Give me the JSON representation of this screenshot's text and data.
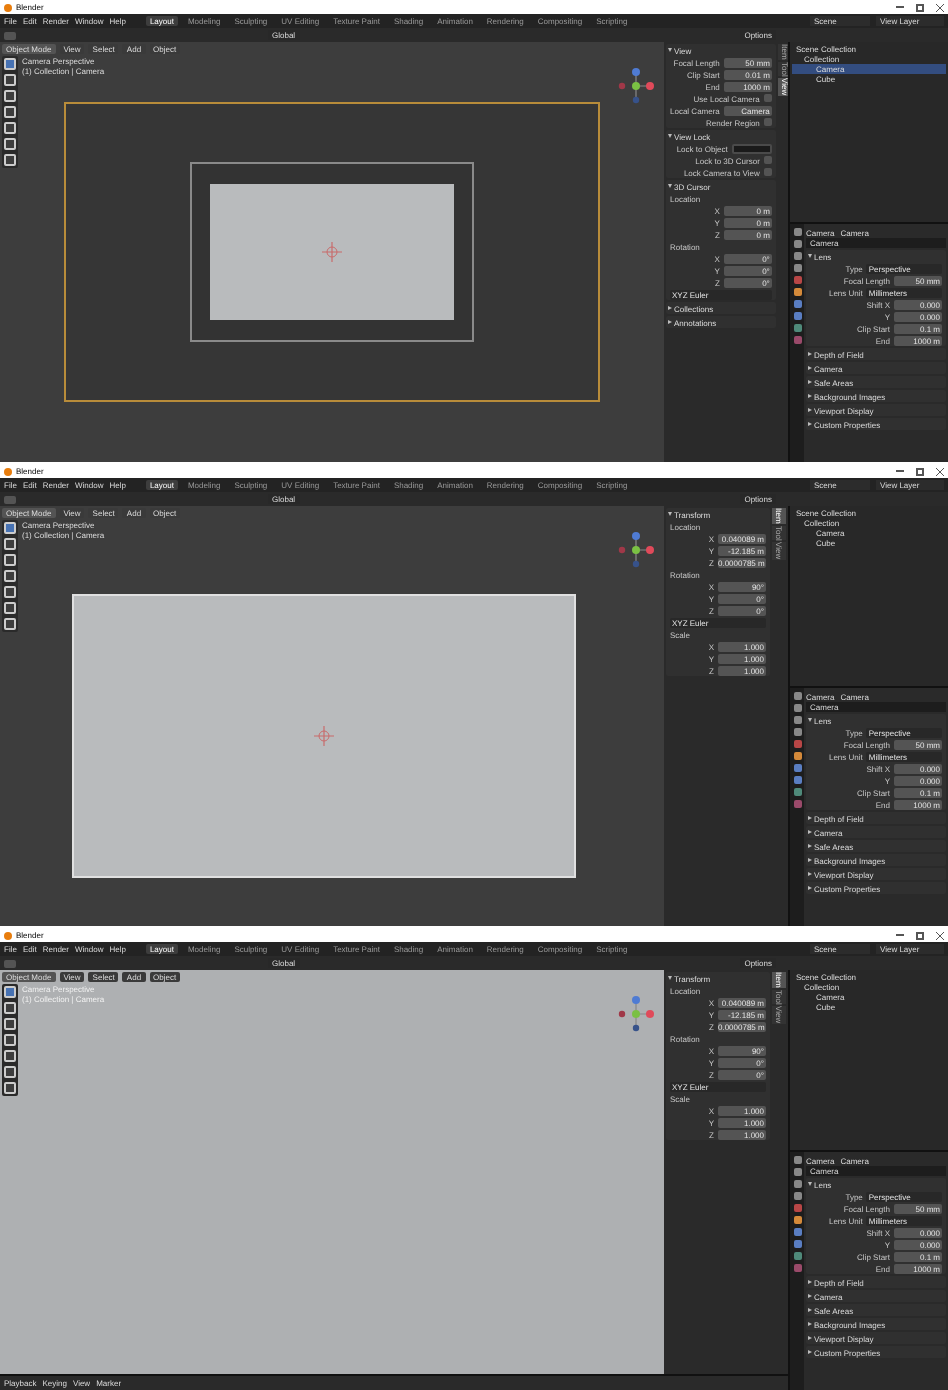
{
  "windows": [
    {
      "title": "Blender",
      "menus": [
        "File",
        "Edit",
        "Render",
        "Window",
        "Help"
      ],
      "workspaces": [
        {
          "label": "Layout",
          "selected": true
        },
        {
          "label": "Modeling",
          "selected": false
        },
        {
          "label": "Sculpting",
          "selected": false
        },
        {
          "label": "UV Editing",
          "selected": false
        },
        {
          "label": "Texture Paint",
          "selected": false
        },
        {
          "label": "Shading",
          "selected": false
        },
        {
          "label": "Animation",
          "selected": false
        },
        {
          "label": "Rendering",
          "selected": false
        },
        {
          "label": "Compositing",
          "selected": false
        },
        {
          "label": "Scripting",
          "selected": false
        }
      ],
      "scene": "Scene",
      "view_layer": "View Layer",
      "header_menus": [
        "Object Mode",
        "View",
        "Select",
        "Add",
        "Object"
      ],
      "orientation": "Global",
      "options": "Options",
      "viewport_info": [
        "Camera Perspective",
        "(1) Collection | Camera"
      ],
      "viewport": {
        "kind": "camera_frame"
      },
      "sidebar_tabs": [
        {
          "label": "Item",
          "selected": false
        },
        {
          "label": "Tool",
          "selected": false
        },
        {
          "label": "View",
          "selected": true
        }
      ],
      "sidebar_panels": [
        {
          "title": "View",
          "expanded": true,
          "rows": [
            {
              "kind": "field",
              "label": "Focal Length",
              "value": "50 mm"
            },
            {
              "kind": "field",
              "label": "Clip Start",
              "value": "0.01 m"
            },
            {
              "kind": "field",
              "label": "End",
              "value": "1000 m"
            },
            {
              "kind": "check",
              "label": "Use Local Camera",
              "checked": false
            },
            {
              "kind": "field",
              "label": "Local Camera",
              "value": "Camera"
            },
            {
              "kind": "check",
              "label": "Render Region",
              "checked": false
            }
          ]
        },
        {
          "title": "View Lock",
          "expanded": true,
          "rows": [
            {
              "kind": "picker",
              "label": "Lock to Object"
            },
            {
              "kind": "check",
              "label": "Lock to 3D Cursor",
              "checked": false
            },
            {
              "kind": "check",
              "label": "Lock Camera to View",
              "checked": false
            }
          ]
        },
        {
          "title": "3D Cursor",
          "expanded": true,
          "rows": [
            {
              "kind": "label",
              "label": "Location"
            },
            {
              "kind": "field",
              "label": "X",
              "value": "0 m"
            },
            {
              "kind": "field",
              "label": "Y",
              "value": "0 m"
            },
            {
              "kind": "field",
              "label": "Z",
              "value": "0 m"
            },
            {
              "kind": "label",
              "label": "Rotation"
            },
            {
              "kind": "field",
              "label": "X",
              "value": "0°"
            },
            {
              "kind": "field",
              "label": "Y",
              "value": "0°"
            },
            {
              "kind": "field",
              "label": "Z",
              "value": "0°"
            },
            {
              "kind": "dropdown",
              "label": "XYZ Euler"
            }
          ]
        },
        {
          "title": "Collections",
          "expanded": false
        },
        {
          "title": "Annotations",
          "expanded": false
        }
      ],
      "outliner": {
        "title": "Scene Collection",
        "items": [
          {
            "label": "Collection",
            "selected": false,
            "children": [
              {
                "label": "Camera",
                "selected": true
              },
              {
                "label": "Cube",
                "selected": false
              }
            ]
          }
        ]
      },
      "properties": {
        "tabs": [
          "Camera",
          "Camera"
        ],
        "datablock": "Camera",
        "panels": [
          {
            "title": "Lens",
            "expanded": true,
            "rows": [
              {
                "kind": "dropdown",
                "label": "Type",
                "value": "Perspective"
              },
              {
                "kind": "field",
                "label": "Focal Length",
                "value": "50 mm"
              },
              {
                "kind": "dropdown",
                "label": "Lens Unit",
                "value": "Millimeters"
              },
              {
                "kind": "field",
                "label": "Shift X",
                "value": "0.000"
              },
              {
                "kind": "field",
                "label": "Y",
                "value": "0.000"
              },
              {
                "kind": "field",
                "label": "Clip Start",
                "value": "0.1 m"
              },
              {
                "kind": "field",
                "label": "End",
                "value": "1000 m"
              }
            ]
          },
          {
            "title": "Depth of Field",
            "expanded": false
          },
          {
            "title": "Camera",
            "expanded": false
          },
          {
            "title": "Safe Areas",
            "expanded": false
          },
          {
            "title": "Background Images",
            "expanded": false
          },
          {
            "title": "Viewport Display",
            "expanded": false
          },
          {
            "title": "Custom Properties",
            "expanded": false
          }
        ]
      }
    },
    {
      "title": "Blender",
      "menus": [
        "File",
        "Edit",
        "Render",
        "Window",
        "Help"
      ],
      "workspaces": [
        {
          "label": "Layout",
          "selected": true
        },
        {
          "label": "Modeling",
          "selected": false
        },
        {
          "label": "Sculpting",
          "selected": false
        },
        {
          "label": "UV Editing",
          "selected": false
        },
        {
          "label": "Texture Paint",
          "selected": false
        },
        {
          "label": "Shading",
          "selected": false
        },
        {
          "label": "Animation",
          "selected": false
        },
        {
          "label": "Rendering",
          "selected": false
        },
        {
          "label": "Compositing",
          "selected": false
        },
        {
          "label": "Scripting",
          "selected": false
        }
      ],
      "scene": "Scene",
      "view_layer": "View Layer",
      "header_menus": [
        "Object Mode",
        "View",
        "Select",
        "Add",
        "Object"
      ],
      "orientation": "Global",
      "options": "Options",
      "viewport_info": [
        "Camera Perspective",
        "(1) Collection | Camera"
      ],
      "viewport": {
        "kind": "camera_fill"
      },
      "sidebar_tabs": [
        {
          "label": "Item",
          "selected": true
        },
        {
          "label": "Tool",
          "selected": false
        },
        {
          "label": "View",
          "selected": false
        }
      ],
      "sidebar_panels": [
        {
          "title": "Transform",
          "expanded": true,
          "rows": [
            {
              "kind": "label",
              "label": "Location"
            },
            {
              "kind": "field",
              "label": "X",
              "value": "0.040089 m"
            },
            {
              "kind": "field",
              "label": "Y",
              "value": "-12.185 m"
            },
            {
              "kind": "field",
              "label": "Z",
              "value": "0.0000785 m"
            },
            {
              "kind": "label",
              "label": "Rotation"
            },
            {
              "kind": "field",
              "label": "X",
              "value": "90°"
            },
            {
              "kind": "field",
              "label": "Y",
              "value": "0°"
            },
            {
              "kind": "field",
              "label": "Z",
              "value": "0°"
            },
            {
              "kind": "dropdown",
              "label": "XYZ Euler"
            },
            {
              "kind": "label",
              "label": "Scale"
            },
            {
              "kind": "field",
              "label": "X",
              "value": "1.000"
            },
            {
              "kind": "field",
              "label": "Y",
              "value": "1.000"
            },
            {
              "kind": "field",
              "label": "Z",
              "value": "1.000"
            }
          ]
        }
      ],
      "outliner": {
        "title": "Scene Collection",
        "items": [
          {
            "label": "Collection",
            "selected": false,
            "children": [
              {
                "label": "Camera",
                "selected": false
              },
              {
                "label": "Cube",
                "selected": false
              }
            ]
          }
        ]
      },
      "properties": {
        "tabs": [
          "Camera",
          "Camera"
        ],
        "datablock": "Camera",
        "panels": [
          {
            "title": "Lens",
            "expanded": true,
            "rows": [
              {
                "kind": "dropdown",
                "label": "Type",
                "value": "Perspective"
              },
              {
                "kind": "field",
                "label": "Focal Length",
                "value": "50 mm"
              },
              {
                "kind": "dropdown",
                "label": "Lens Unit",
                "value": "Millimeters"
              },
              {
                "kind": "field",
                "label": "Shift X",
                "value": "0.000"
              },
              {
                "kind": "field",
                "label": "Y",
                "value": "0.000"
              },
              {
                "kind": "field",
                "label": "Clip Start",
                "value": "0.1 m"
              },
              {
                "kind": "field",
                "label": "End",
                "value": "1000 m"
              }
            ]
          },
          {
            "title": "Depth of Field",
            "expanded": false
          },
          {
            "title": "Camera",
            "expanded": false
          },
          {
            "title": "Safe Areas",
            "expanded": false
          },
          {
            "title": "Background Images",
            "expanded": false
          },
          {
            "title": "Viewport Display",
            "expanded": false
          },
          {
            "title": "Custom Properties",
            "expanded": false
          }
        ]
      }
    },
    {
      "title": "Blender",
      "menus": [
        "File",
        "Edit",
        "Render",
        "Window",
        "Help"
      ],
      "workspaces": [
        {
          "label": "Layout",
          "selected": true
        },
        {
          "label": "Modeling",
          "selected": false
        },
        {
          "label": "Sculpting",
          "selected": false
        },
        {
          "label": "UV Editing",
          "selected": false
        },
        {
          "label": "Texture Paint",
          "selected": false
        },
        {
          "label": "Shading",
          "selected": false
        },
        {
          "label": "Animation",
          "selected": false
        },
        {
          "label": "Rendering",
          "selected": false
        },
        {
          "label": "Compositing",
          "selected": false
        },
        {
          "label": "Scripting",
          "selected": false
        }
      ],
      "scene": "Scene",
      "view_layer": "View Layer",
      "header_menus": [
        "Object Mode",
        "View",
        "Select",
        "Add",
        "Object"
      ],
      "orientation": "Global",
      "options": "Options",
      "viewport_info": [
        "Camera Perspective",
        "(1) Collection | Camera"
      ],
      "viewport": {
        "kind": "full"
      },
      "sidebar_tabs": [
        {
          "label": "Item",
          "selected": true
        },
        {
          "label": "Tool",
          "selected": false
        },
        {
          "label": "View",
          "selected": false
        }
      ],
      "sidebar_panels": [
        {
          "title": "Transform",
          "expanded": true,
          "rows": [
            {
              "kind": "label",
              "label": "Location"
            },
            {
              "kind": "field",
              "label": "X",
              "value": "0.040089 m"
            },
            {
              "kind": "field",
              "label": "Y",
              "value": "-12.185 m"
            },
            {
              "kind": "field",
              "label": "Z",
              "value": "0.0000785 m"
            },
            {
              "kind": "label",
              "label": "Rotation"
            },
            {
              "kind": "field",
              "label": "X",
              "value": "90°"
            },
            {
              "kind": "field",
              "label": "Y",
              "value": "0°"
            },
            {
              "kind": "field",
              "label": "Z",
              "value": "0°"
            },
            {
              "kind": "dropdown",
              "label": "XYZ Euler"
            },
            {
              "kind": "label",
              "label": "Scale"
            },
            {
              "kind": "field",
              "label": "X",
              "value": "1.000"
            },
            {
              "kind": "field",
              "label": "Y",
              "value": "1.000"
            },
            {
              "kind": "field",
              "label": "Z",
              "value": "1.000"
            }
          ]
        }
      ],
      "outliner": {
        "title": "Scene Collection",
        "items": [
          {
            "label": "Collection",
            "selected": false,
            "children": [
              {
                "label": "Camera",
                "selected": false
              },
              {
                "label": "Cube",
                "selected": false
              }
            ]
          }
        ]
      },
      "properties": {
        "tabs": [
          "Camera",
          "Camera"
        ],
        "datablock": "Camera",
        "panels": [
          {
            "title": "Lens",
            "expanded": true,
            "rows": [
              {
                "kind": "dropdown",
                "label": "Type",
                "value": "Perspective"
              },
              {
                "kind": "field",
                "label": "Focal Length",
                "value": "50 mm"
              },
              {
                "kind": "dropdown",
                "label": "Lens Unit",
                "value": "Millimeters"
              },
              {
                "kind": "field",
                "label": "Shift X",
                "value": "0.000"
              },
              {
                "kind": "field",
                "label": "Y",
                "value": "0.000"
              },
              {
                "kind": "field",
                "label": "Clip Start",
                "value": "0.1 m"
              },
              {
                "kind": "field",
                "label": "End",
                "value": "1000 m"
              }
            ]
          },
          {
            "title": "Depth of Field",
            "expanded": false
          },
          {
            "title": "Camera",
            "expanded": false
          },
          {
            "title": "Safe Areas",
            "expanded": false
          },
          {
            "title": "Background Images",
            "expanded": false
          },
          {
            "title": "Viewport Display",
            "expanded": false
          },
          {
            "title": "Custom Properties",
            "expanded": false
          }
        ]
      },
      "timeline_menus": [
        "Playback",
        "Keying",
        "View",
        "Marker"
      ]
    }
  ]
}
